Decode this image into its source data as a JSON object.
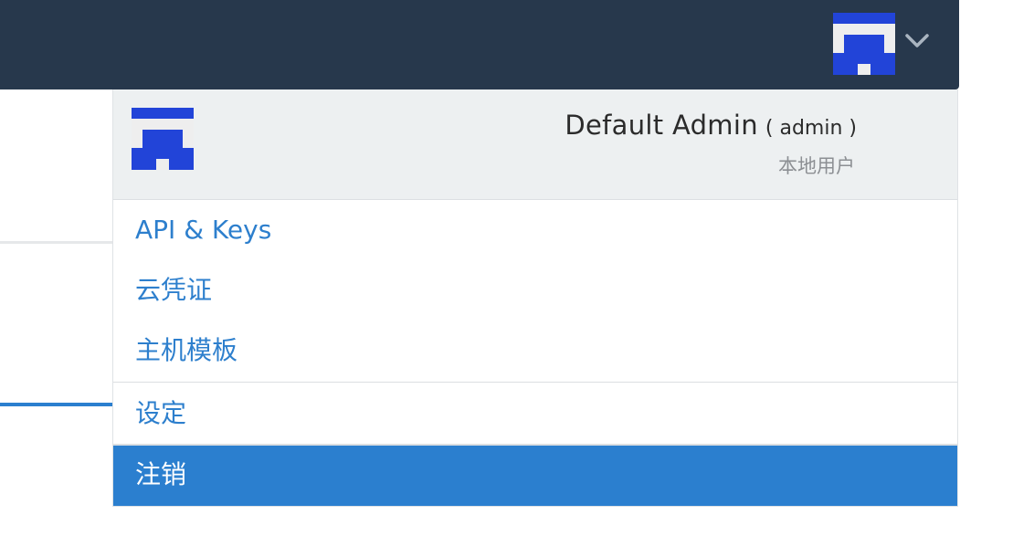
{
  "header": {
    "bar_color": "#27384c",
    "avatar_icon": "user-avatar-icon",
    "dropdown_icon": "chevron-down-icon"
  },
  "user": {
    "display_name": "Default Admin",
    "login": "( admin )",
    "account_type": "本地用户"
  },
  "menu": {
    "api_keys": "API & Keys",
    "cloud_credentials": "云凭证",
    "host_templates": "主机模板",
    "settings": "设定",
    "logout": "注销"
  },
  "colors": {
    "accent": "#2b7fcf",
    "link": "#2d7fcd",
    "header_bg": "#edf0f1",
    "avatar_blue": "#2244d8",
    "avatar_gray": "#eeeeee"
  }
}
